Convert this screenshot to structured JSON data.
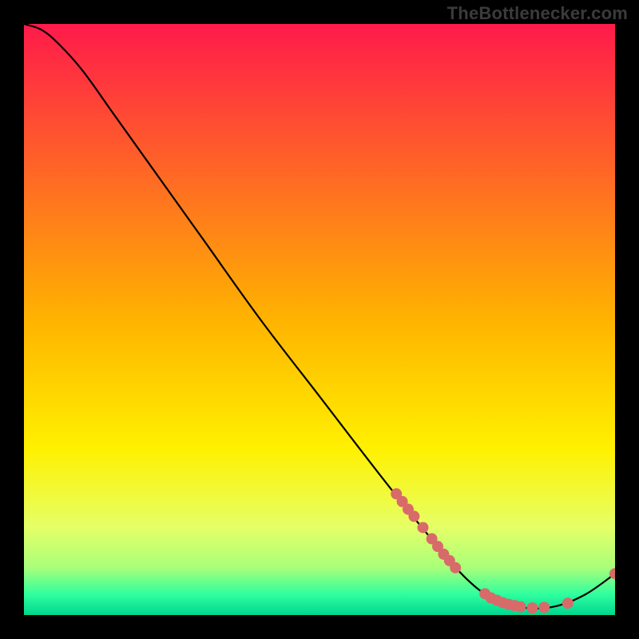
{
  "watermark": "TheBottlenecker.com",
  "chart_data": {
    "type": "line",
    "title": "",
    "xlabel": "",
    "ylabel": "",
    "xlim": [
      0,
      100
    ],
    "ylim": [
      0,
      100
    ],
    "grid": false,
    "legend": false,
    "gradient_stops": [
      {
        "pct": 0.0,
        "color": "#ff1a4b"
      },
      {
        "pct": 0.5,
        "color": "#ffb300"
      },
      {
        "pct": 0.72,
        "color": "#fff100"
      },
      {
        "pct": 0.85,
        "color": "#e6ff66"
      },
      {
        "pct": 0.92,
        "color": "#a8ff7a"
      },
      {
        "pct": 0.965,
        "color": "#2fff9e"
      },
      {
        "pct": 1.0,
        "color": "#00d68f"
      }
    ],
    "curve": [
      {
        "x": 0,
        "y": 100
      },
      {
        "x": 3,
        "y": 99
      },
      {
        "x": 6,
        "y": 96.5
      },
      {
        "x": 10,
        "y": 92
      },
      {
        "x": 15,
        "y": 85
      },
      {
        "x": 20,
        "y": 78
      },
      {
        "x": 30,
        "y": 64
      },
      {
        "x": 40,
        "y": 50
      },
      {
        "x": 50,
        "y": 37
      },
      {
        "x": 60,
        "y": 24
      },
      {
        "x": 68,
        "y": 14
      },
      {
        "x": 75,
        "y": 6
      },
      {
        "x": 80,
        "y": 2.5
      },
      {
        "x": 85,
        "y": 1.2
      },
      {
        "x": 90,
        "y": 1.5
      },
      {
        "x": 95,
        "y": 3.5
      },
      {
        "x": 100,
        "y": 7
      }
    ],
    "markers": [
      {
        "x": 63,
        "y": 20.5
      },
      {
        "x": 64,
        "y": 19.2
      },
      {
        "x": 65,
        "y": 17.9
      },
      {
        "x": 66,
        "y": 16.7
      },
      {
        "x": 67.5,
        "y": 14.8
      },
      {
        "x": 69,
        "y": 12.9
      },
      {
        "x": 70,
        "y": 11.6
      },
      {
        "x": 71,
        "y": 10.3
      },
      {
        "x": 72,
        "y": 9.2
      },
      {
        "x": 73,
        "y": 8.0
      },
      {
        "x": 78,
        "y": 3.6
      },
      {
        "x": 79,
        "y": 2.9
      },
      {
        "x": 80,
        "y": 2.5
      },
      {
        "x": 81,
        "y": 2.1
      },
      {
        "x": 82,
        "y": 1.8
      },
      {
        "x": 83,
        "y": 1.6
      },
      {
        "x": 84,
        "y": 1.4
      },
      {
        "x": 86,
        "y": 1.2
      },
      {
        "x": 88,
        "y": 1.3
      },
      {
        "x": 92,
        "y": 2.0
      },
      {
        "x": 100,
        "y": 7.0
      }
    ],
    "marker_color": "#d86a6a",
    "marker_radius": 7,
    "line_color": "#000000",
    "line_width": 2.2
  }
}
